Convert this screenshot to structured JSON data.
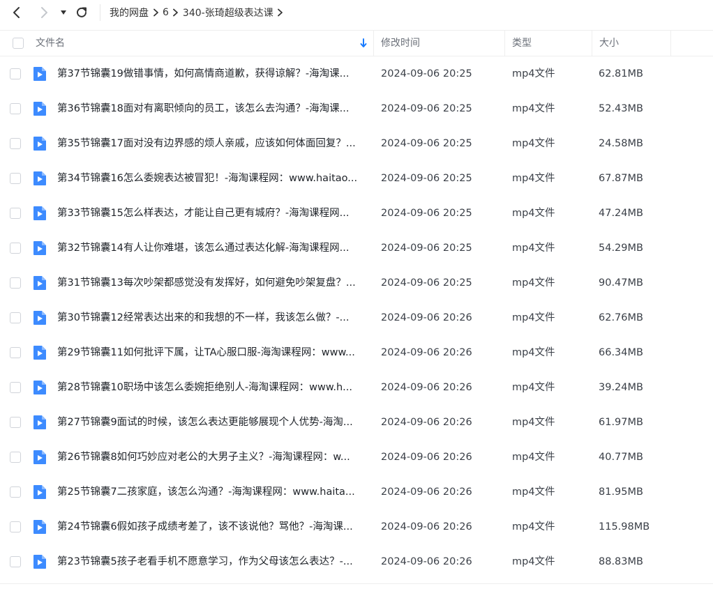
{
  "nav": {
    "back_icon": "chevron-left-icon",
    "forward_icon": "chevron-right-icon",
    "history_icon": "caret-down-icon",
    "refresh_icon": "refresh-icon"
  },
  "breadcrumb": [
    "我的网盘",
    "6",
    "340-张琦超级表达课"
  ],
  "columns": {
    "name": "文件名",
    "modified": "修改时间",
    "type": "类型",
    "size": "大小"
  },
  "colors": {
    "accent": "#1a7cff",
    "file_icon": "#3d8bff"
  },
  "files": [
    {
      "name": "第37节锦囊19做错事情，如何高情商道歉，获得谅解？-海淘课...",
      "modified": "2024-09-06 20:25",
      "type": "mp4文件",
      "size": "62.81MB"
    },
    {
      "name": "第36节锦囊18面对有离职倾向的员工，该怎么去沟通？-海淘课...",
      "modified": "2024-09-06 20:25",
      "type": "mp4文件",
      "size": "52.43MB"
    },
    {
      "name": "第35节锦囊17面对没有边界感的烦人亲戚，应该如何体面回复？...",
      "modified": "2024-09-06 20:25",
      "type": "mp4文件",
      "size": "24.58MB"
    },
    {
      "name": "第34节锦囊16怎么委婉表达被冒犯！-海淘课程网：www.haitao...",
      "modified": "2024-09-06 20:25",
      "type": "mp4文件",
      "size": "67.87MB"
    },
    {
      "name": "第33节锦囊15怎么样表达，才能让自己更有城府？-海淘课程网...",
      "modified": "2024-09-06 20:25",
      "type": "mp4文件",
      "size": "47.24MB"
    },
    {
      "name": "第32节锦囊14有人让你难堪，该怎么通过表达化解-海淘课程网...",
      "modified": "2024-09-06 20:25",
      "type": "mp4文件",
      "size": "54.29MB"
    },
    {
      "name": "第31节锦囊13每次吵架都感觉没有发挥好，如何避免吵架复盘？...",
      "modified": "2024-09-06 20:25",
      "type": "mp4文件",
      "size": "90.47MB"
    },
    {
      "name": "第30节锦囊12经常表达出来的和我想的不一样，我该怎么做？-...",
      "modified": "2024-09-06 20:26",
      "type": "mp4文件",
      "size": "62.76MB"
    },
    {
      "name": "第29节锦囊11如何批评下属，让TA心服口服-海淘课程网：www...",
      "modified": "2024-09-06 20:26",
      "type": "mp4文件",
      "size": "66.34MB"
    },
    {
      "name": "第28节锦囊10职场中该怎么委婉拒绝别人-海淘课程网：www.h...",
      "modified": "2024-09-06 20:26",
      "type": "mp4文件",
      "size": "39.24MB"
    },
    {
      "name": "第27节锦囊9面试的时候，该怎么表达更能够展现个人优势-海淘...",
      "modified": "2024-09-06 20:26",
      "type": "mp4文件",
      "size": "61.97MB"
    },
    {
      "name": "第26节锦囊8如何巧妙应对老公的大男子主义？-海淘课程网：w...",
      "modified": "2024-09-06 20:26",
      "type": "mp4文件",
      "size": "40.77MB"
    },
    {
      "name": "第25节锦囊7二孩家庭，该怎么沟通？-海淘课程网：www.haita...",
      "modified": "2024-09-06 20:26",
      "type": "mp4文件",
      "size": "81.95MB"
    },
    {
      "name": "第24节锦囊6假如孩子成绩考差了，该不该说他？骂他？-海淘课...",
      "modified": "2024-09-06 20:26",
      "type": "mp4文件",
      "size": "115.98MB"
    },
    {
      "name": "第23节锦囊5孩子老看手机不愿意学习，作为父母该怎么表达？-...",
      "modified": "2024-09-06 20:26",
      "type": "mp4文件",
      "size": "88.83MB"
    }
  ]
}
